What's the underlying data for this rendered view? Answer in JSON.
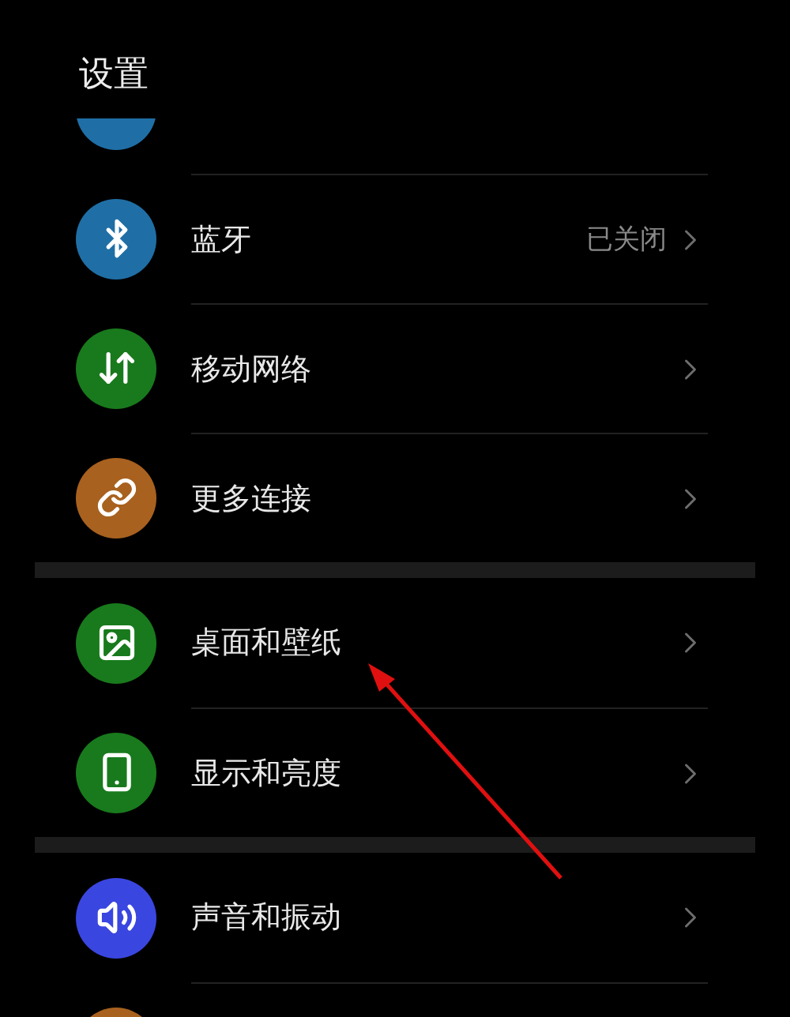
{
  "title": "设置",
  "groups": [
    {
      "items": [
        {
          "kind": "partial",
          "color": "#1f6fa6"
        },
        {
          "kind": "row",
          "label": "蓝牙",
          "value": "已关闭",
          "color": "#1f6fa6"
        },
        {
          "kind": "row",
          "label": "移动网络",
          "color": "#187a1c"
        },
        {
          "kind": "row",
          "label": "更多连接",
          "color": "#a8611f"
        }
      ]
    },
    {
      "items": [
        {
          "kind": "row",
          "label": "桌面和壁纸",
          "color": "#187a1c"
        },
        {
          "kind": "row",
          "label": "显示和亮度",
          "color": "#187a1c"
        }
      ]
    },
    {
      "items": [
        {
          "kind": "row",
          "label": "声音和振动",
          "color": "#3a46e0"
        },
        {
          "kind": "partial",
          "color": "#a8611f"
        }
      ]
    }
  ]
}
